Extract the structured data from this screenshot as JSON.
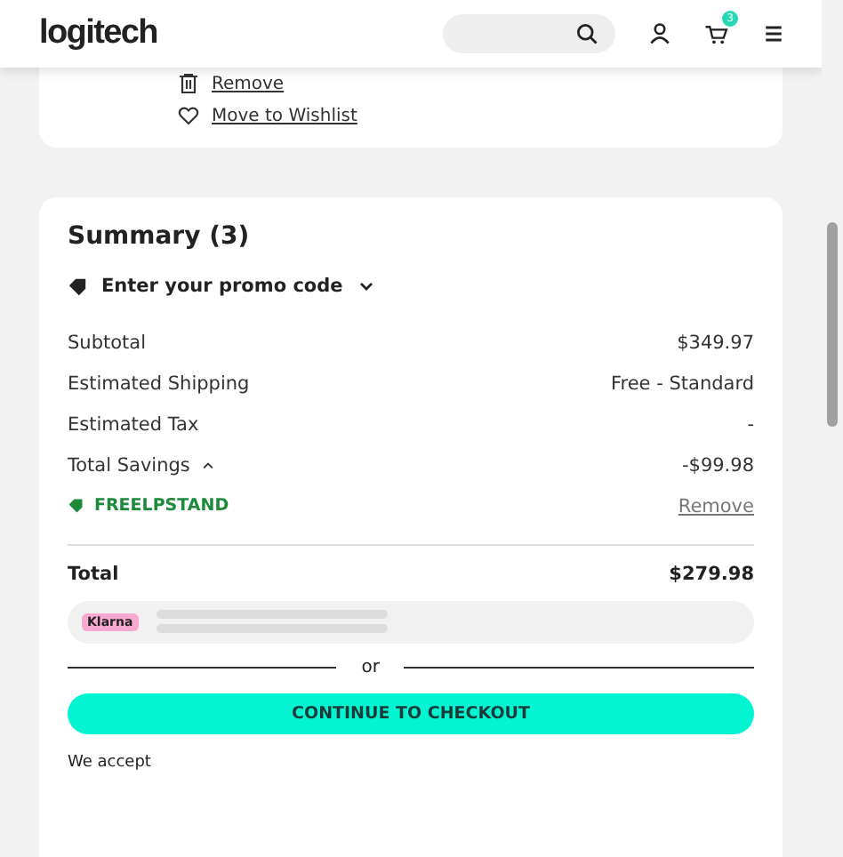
{
  "header": {
    "logo": "logitech",
    "cart_count": "3"
  },
  "item_actions": [
    {
      "kind": "trash",
      "label": "Remove"
    },
    {
      "kind": "heart",
      "label": "Move to Wishlist"
    }
  ],
  "summary": {
    "title": "Summary (3)",
    "promo_label": "Enter your promo code",
    "promo_expanded": false,
    "lines": [
      {
        "label": "Subtotal",
        "value": "$349.97"
      },
      {
        "label": "Estimated Shipping",
        "value": "Free - Standard"
      },
      {
        "label": "Estimated Tax",
        "value": "-"
      }
    ],
    "savings": {
      "label": "Total Savings",
      "value": "-$99.98",
      "expanded": true
    },
    "applied_code": {
      "code": "FREELPSTAND",
      "action": "Remove"
    },
    "total": {
      "label": "Total",
      "value": "$279.98"
    },
    "klarna": {
      "label": "Klarna"
    },
    "divider_text": "or",
    "checkout": "CONTINUE TO CHECKOUT",
    "accept": "We accept"
  }
}
